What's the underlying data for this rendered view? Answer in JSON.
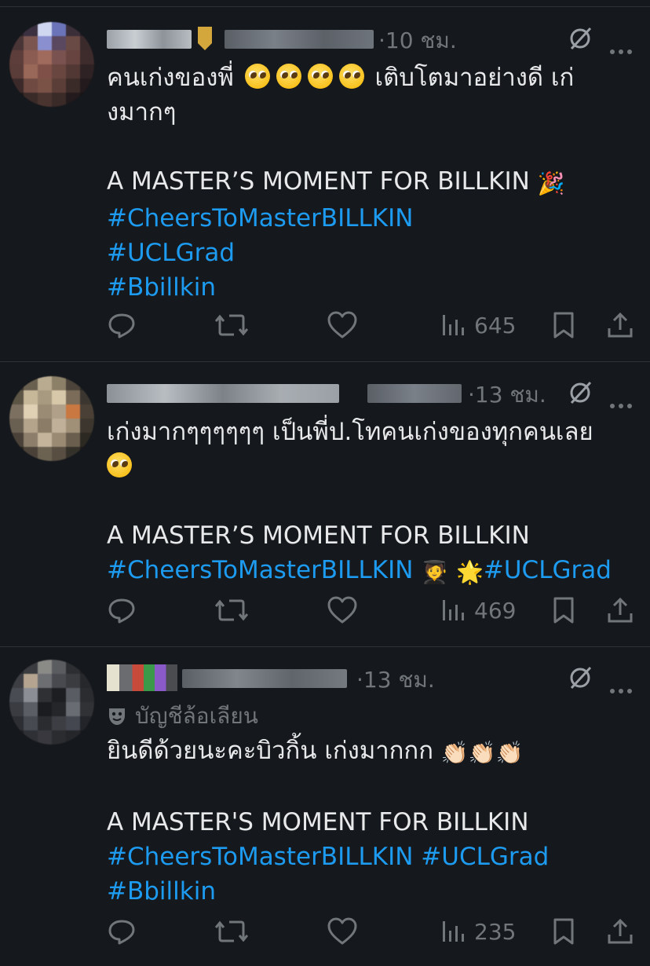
{
  "tweets": [
    {
      "time": "·10 ชม.",
      "lines": [
        {
          "pre": "คนเก่งของพี่",
          "faces": 4,
          "post": "เติบโตมาอย่างดี เก่"
        },
        {
          "text": "งมากๆ"
        }
      ],
      "headline": "A MASTER’S MOMENT FOR BILLKIN",
      "headline_emoji": "🎉",
      "tags": [
        "#CheersToMasterBILLKIN",
        "#UCLGrad",
        "#Bbillkin"
      ],
      "views": "645"
    },
    {
      "time": "·13 ชม.",
      "text": "เก่งมากๆๆๆๆๆๆ เป็นพี่ป.โทคนเก่งของทุกคนเลย",
      "headline": "A MASTER’S MOMENT FOR BILLKIN",
      "tags": [
        "#CheersToMasterBILLKIN",
        "#UCLGrad"
      ],
      "tag_emojis": [
        "🧑‍🎓",
        "🌟"
      ],
      "views": "469"
    },
    {
      "time": "·13 ชม.",
      "parody_label": "บัญชีล้อเลียน",
      "text": "ยินดีด้วยนะคะบิวกิ้น เก่งมากกก",
      "text_emojis": "👏🏻👏🏻👏🏻",
      "headline": "A MASTER'S MOMENT FOR BILLKIN",
      "tags": [
        "#CheersToMasterBILLKIN",
        "#UCLGrad",
        "#Bbillkin"
      ],
      "views": "235"
    }
  ],
  "icons": [
    "reply-icon",
    "retweet-icon",
    "like-icon",
    "views-icon",
    "bookmark-icon",
    "share-icon",
    "grok-icon",
    "more-icon",
    "parody-mask-icon"
  ],
  "colors": {
    "background": "#15181c",
    "text": "#e7e9ea",
    "muted": "#71767b",
    "link": "#1d9bf0",
    "divider": "#2f3336"
  }
}
